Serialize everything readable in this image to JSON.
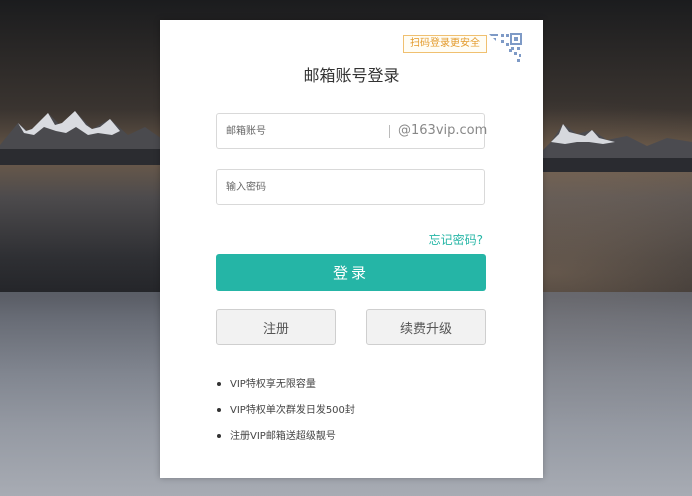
{
  "qr": {
    "tip": "扫码登录更安全",
    "icon": "qr-code-icon"
  },
  "login": {
    "title": "邮箱账号登录",
    "account_placeholder": "邮箱账号",
    "domain": "@163vip.com",
    "password_placeholder": "输入密码",
    "forgot_label": "忘记密码?",
    "submit_label": "登录"
  },
  "actions": {
    "register_label": "注册",
    "renew_label": "续费升级"
  },
  "features": [
    "VIP特权享无限容量",
    "VIP特权单次群发日发500封",
    "注册VIP邮箱送超级靓号"
  ],
  "colors": {
    "accent": "#25b5a6",
    "tip_text": "#e39a2b",
    "tip_border": "#f0c070",
    "qr_icon": "#7e9ac6"
  }
}
